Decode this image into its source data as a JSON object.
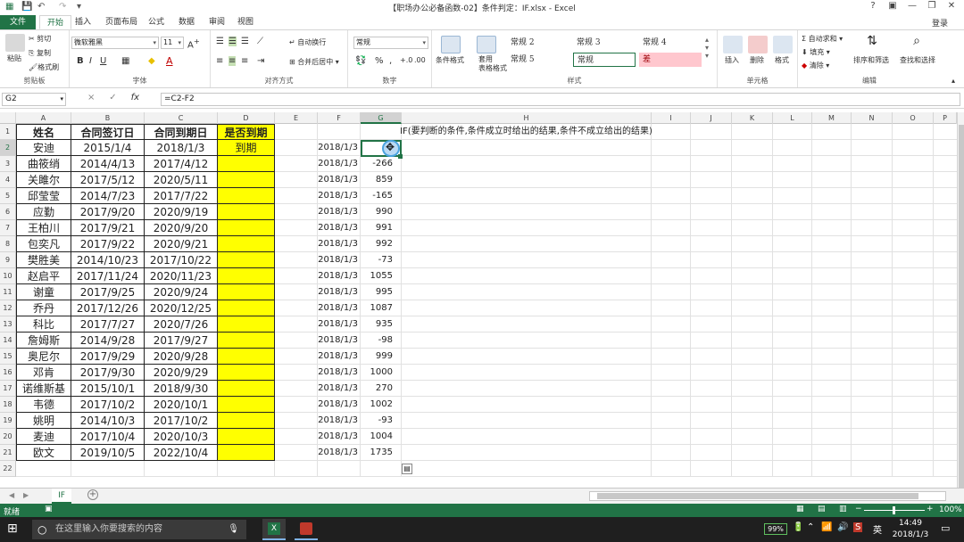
{
  "window": {
    "title": "【职场办公必备函数-02】条件判定：IF.xlsx - Excel",
    "help": "?",
    "login": "登录"
  },
  "tabs": [
    "文件",
    "开始",
    "插入",
    "页面布局",
    "公式",
    "数据",
    "审阅",
    "视图"
  ],
  "ribbon": {
    "clipboard": {
      "paste": "粘贴",
      "cut": "剪切",
      "copy": "复制",
      "format_painter": "格式刷",
      "label": "剪贴板"
    },
    "font": {
      "name": "微软雅黑",
      "size": "11",
      "bold": "B",
      "italic": "I",
      "underline": "U",
      "label": "字体"
    },
    "align": {
      "wrap": "自动换行",
      "merge": "合并后居中",
      "label": "对齐方式"
    },
    "number": {
      "format": "常规",
      "percent": "%",
      "label": "数字"
    },
    "styles": {
      "cond": "条件格式",
      "table": "套用\n表格格式",
      "s1": "常规 2",
      "s2": "常规 3",
      "s3": "常规 4",
      "s4": "常规 5",
      "s5": "常规",
      "s6": "差",
      "label": "样式"
    },
    "cells": {
      "insert": "插入",
      "delete": "删除",
      "format": "格式",
      "label": "单元格"
    },
    "edit": {
      "autosum": "自动求和",
      "fill": "填充",
      "clear": "清除",
      "sort": "排序和筛选",
      "find": "查找和选择",
      "label": "编辑"
    }
  },
  "formula_bar": {
    "name_box": "G2",
    "cancel": "×",
    "enter": "✓",
    "fx": "fx",
    "formula": "=C2-F2"
  },
  "columns": [
    "A",
    "B",
    "C",
    "D",
    "E",
    "F",
    "G",
    "H",
    "I",
    "J",
    "K",
    "L",
    "M",
    "N",
    "O",
    "P"
  ],
  "rows": [
    "1",
    "2",
    "3",
    "4",
    "5",
    "6",
    "7",
    "8",
    "9",
    "10",
    "11",
    "12",
    "13",
    "14",
    "15",
    "16",
    "17",
    "18",
    "19",
    "20",
    "21",
    "22"
  ],
  "table": {
    "headers": [
      "姓名",
      "合同签订日",
      "合同到期日",
      "是否到期"
    ],
    "rows": [
      [
        "安迪",
        "2015/1/4",
        "2018/1/3",
        "到期"
      ],
      [
        "曲筱绡",
        "2014/4/13",
        "2017/4/12",
        ""
      ],
      [
        "关雎尔",
        "2017/5/12",
        "2020/5/11",
        ""
      ],
      [
        "邱莹莹",
        "2014/7/23",
        "2017/7/22",
        ""
      ],
      [
        "应勤",
        "2017/9/20",
        "2020/9/19",
        ""
      ],
      [
        "王柏川",
        "2017/9/21",
        "2020/9/20",
        ""
      ],
      [
        "包奕凡",
        "2017/9/22",
        "2020/9/21",
        ""
      ],
      [
        "樊胜美",
        "2014/10/23",
        "2017/10/22",
        ""
      ],
      [
        "赵启平",
        "2017/11/24",
        "2020/11/23",
        ""
      ],
      [
        "谢童",
        "2017/9/25",
        "2020/9/24",
        ""
      ],
      [
        "乔丹",
        "2017/12/26",
        "2020/12/25",
        ""
      ],
      [
        "科比",
        "2017/7/27",
        "2020/7/26",
        ""
      ],
      [
        "詹姆斯",
        "2014/9/28",
        "2017/9/27",
        ""
      ],
      [
        "奥尼尔",
        "2017/9/29",
        "2020/9/28",
        ""
      ],
      [
        "邓肯",
        "2017/9/30",
        "2020/9/29",
        ""
      ],
      [
        "诺维斯基",
        "2015/10/1",
        "2018/9/30",
        ""
      ],
      [
        "韦德",
        "2017/10/2",
        "2020/10/1",
        ""
      ],
      [
        "姚明",
        "2014/10/3",
        "2017/10/2",
        ""
      ],
      [
        "麦迪",
        "2017/10/4",
        "2020/10/3",
        ""
      ],
      [
        "欧文",
        "2019/10/5",
        "2022/10/4",
        ""
      ]
    ]
  },
  "col_f": [
    "2018/1/3",
    "2018/1/3",
    "2018/1/3",
    "2018/1/3",
    "2018/1/3",
    "2018/1/3",
    "2018/1/3",
    "2018/1/3",
    "2018/1/3",
    "2018/1/3",
    "2018/1/3",
    "2018/1/3",
    "2018/1/3",
    "2018/1/3",
    "2018/1/3",
    "2018/1/3",
    "2018/1/3",
    "2018/1/3",
    "2018/1/3",
    "2018/1/3"
  ],
  "col_g": [
    "0",
    "-266",
    "859",
    "-165",
    "990",
    "991",
    "992",
    "-73",
    "1055",
    "995",
    "1087",
    "935",
    "-98",
    "999",
    "1000",
    "270",
    "1002",
    "-93",
    "1004",
    "1735"
  ],
  "h1_note": "IF(要判断的条件,条件成立时给出的结果,条件不成立给出的结果)",
  "sheet": {
    "name": "IF",
    "add": "+"
  },
  "status": {
    "ready": "就绪",
    "zoom": "100%"
  },
  "taskbar": {
    "search": "在这里输入你要搜索的内容",
    "battery": "99%",
    "time": "14:49",
    "date": "2018/1/3"
  }
}
